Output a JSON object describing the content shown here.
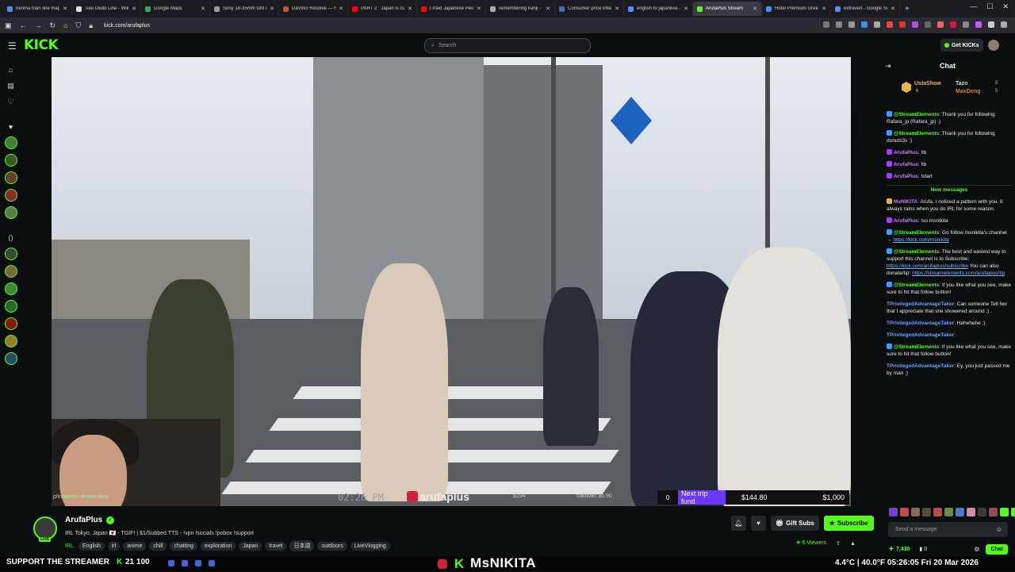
{
  "browser": {
    "tabs": [
      {
        "label": "nerima train line map",
        "color": "#4d8ef7"
      },
      {
        "label": "Toei Ōedo Line - Wiki",
        "color": "#dddddd"
      },
      {
        "label": "Google Maps",
        "color": "#34a853"
      },
      {
        "label": "Sony 18-35mm GM L",
        "color": "#999999"
      },
      {
        "label": "DaVinci Resolve — M",
        "color": "#c7552f"
      },
      {
        "label": "PART 2 : Japan is curr",
        "color": "#ff0000"
      },
      {
        "label": "I Paid Japanese Peopl",
        "color": "#ff0000"
      },
      {
        "label": "remembering kanji - C",
        "color": "#aaaaaa"
      },
      {
        "label": "Consumer price inflati",
        "color": "#3b73b9"
      },
      {
        "label": "english to japanese -",
        "color": "#4d8ef7"
      },
      {
        "label": "ArufaPlus Stream",
        "color": "#53fc18"
      },
      {
        "label": "Hotel Premium Green",
        "color": "#4d8ef7"
      },
      {
        "label": "extravert - Google Se",
        "color": "#4d8ef7"
      }
    ],
    "new_tab": "+",
    "url": "kick.com/arufaplus"
  },
  "kick": {
    "logo": "KICK",
    "search_placeholder": "Search",
    "get_kicks": "Get KICKs"
  },
  "video": {
    "overlay_left": "p!instreen.   In-test-ines.",
    "overlay_time": "02:26 PM",
    "overlay_brand": "arufaplus",
    "overlay_small_1": "$194",
    "overlay_small_2": "sakikakt $6.90",
    "trip_zero": "0",
    "trip_label": "Next trip fund",
    "trip_amount": "$144.80",
    "trip_goal": "$1,000",
    "trip_progress": 0.1448
  },
  "stream": {
    "channel": "ArufaPlus",
    "live": "LIVE",
    "title": "IRL Tokyo, Japan 🇯🇵 - TGIF! | $1/Subbed TTS - !vpn !socials !pobox !support",
    "category": "IRL",
    "tags": [
      "English",
      "irl",
      "anime",
      "chill",
      "chatting",
      "exploration",
      "Japan",
      "travel",
      "日本語",
      "outdoors",
      "LiveVlogging"
    ],
    "gift_subs": "Gift Subs",
    "subscribe": "Subscribe",
    "viewers": "6 Viewers"
  },
  "chat": {
    "title": "Chat",
    "leaderboard": [
      {
        "name": "UstaShow",
        "count": "6"
      },
      {
        "name": "Tazo",
        "count": "5"
      },
      {
        "name": "MaxDong",
        "count": "5"
      }
    ],
    "messages_before": [
      {
        "user": "@StreamElements",
        "color": "#53fc18",
        "text": ": Thank you for following Rafara_jp (Rafara_jp) :)",
        "badge": "#3aa0ff"
      },
      {
        "user": "@StreamElements",
        "color": "#53fc18",
        "text": ": Thank you for following donuts3s :)",
        "badge": "#3aa0ff"
      },
      {
        "user": "ArufaPlus",
        "color": "#c77dff",
        "text": ": !lb",
        "badge": "#a93dff"
      },
      {
        "user": "ArufaPlus",
        "color": "#c77dff",
        "text": ": !lb",
        "badge": "#a93dff"
      },
      {
        "user": "ArufaPlus",
        "color": "#c77dff",
        "text": ": !start",
        "badge": "#a93dff"
      }
    ],
    "new_messages_label": "New messages",
    "messages_after": [
      {
        "user": "MsNIKITA",
        "color": "#c77dff",
        "text": ": Arufa, I noticed a pattern with you. It always rains when you do IRL for some reason.",
        "badge": "#e6b44a"
      },
      {
        "user": "ArufaPlus",
        "color": "#c77dff",
        "text": ": !so msnikita",
        "badge": "#a93dff"
      },
      {
        "user": "@StreamElements",
        "color": "#53fc18",
        "text": ": Go follow msnikita's channel → ",
        "link": "https://kick.com/msnikita",
        "badge": "#3aa0ff"
      },
      {
        "user": "@StreamElements",
        "color": "#53fc18",
        "text": ": The best and easiest way to support this channel is to Subscribe: ",
        "link": "https://kick.com/arufaplus/subscribe",
        "text2": " You can also donate/tip: ",
        "link2": "https://streamelements.com/arufaplus/tip",
        "badge": "#3aa0ff"
      },
      {
        "user": "@StreamElements",
        "color": "#53fc18",
        "text": ": If you like what you see, make sure to hit that follow button!",
        "badge": "#3aa0ff"
      },
      {
        "user": "TPrivilegedAdvantageTaker",
        "color": "#6aa3ff",
        "text": ": Can someone Tell her that I appreciate that she showered around ;) .",
        "badge": ""
      },
      {
        "user": "TPrivilegedAdvantageTaker",
        "color": "#6aa3ff",
        "text": ": Hehehehe ;)",
        "badge": ""
      },
      {
        "user": "TPrivilegedAdvantageTaker",
        "color": "#6aa3ff",
        "text": ":",
        "badge": ""
      },
      {
        "user": "@StreamElements",
        "color": "#53fc18",
        "text": ": If you like what you see, make sure to hit that follow button!",
        "badge": "#3aa0ff"
      },
      {
        "user": "TPrivilegedAdvantageTaker",
        "color": "#6aa3ff",
        "text": ": Ey, you just passed me by man ;)",
        "badge": ""
      }
    ],
    "input_placeholder": "Send a message",
    "kicks": "7,430",
    "zero": "0",
    "chat_button": "Chat"
  },
  "ticker": {
    "support": "SUPPORT THE STREAMER",
    "k": "K",
    "nums": "21  100",
    "channel_name": "MsNIKITA",
    "weather": "4.4°C | 40.0°F   05:26:05   Fri 20 Mar 2026"
  }
}
